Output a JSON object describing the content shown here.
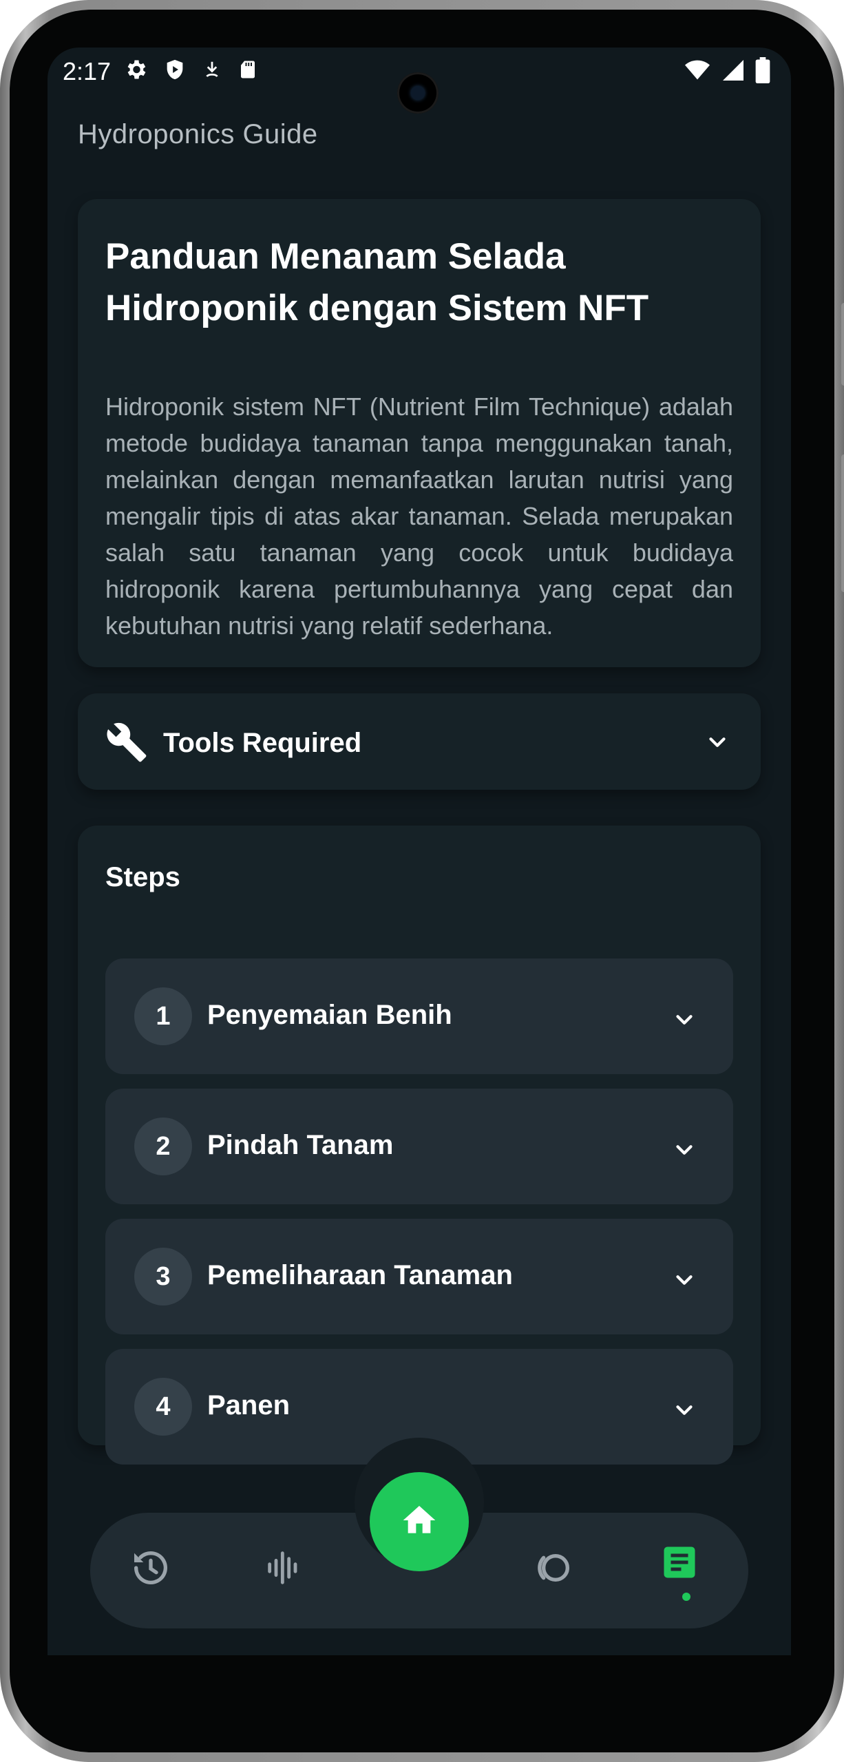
{
  "status_bar": {
    "time": "2:17",
    "left_icons": [
      "gear-icon",
      "shield-play-icon",
      "download-icon",
      "sd-card-icon"
    ],
    "right_icons": [
      "wifi-icon",
      "signal-icon",
      "battery-icon"
    ]
  },
  "app": {
    "title": "Hydroponics Guide"
  },
  "intro": {
    "title": "Panduan Menanam Selada Hidroponik dengan Sistem NFT",
    "description": "Hidroponik sistem NFT (Nutrient Film Technique) adalah metode budidaya tanaman tanpa menggunakan tanah, melainkan dengan memanfaatkan larutan nutrisi yang mengalir tipis di atas akar tanaman. Selada merupakan salah satu tanaman yang cocok untuk budidaya hidroponik karena pertumbuhannya yang cepat dan kebutuhan nutrisi yang relatif sederhana."
  },
  "tools": {
    "label": "Tools Required",
    "icon": "wrench-icon"
  },
  "steps": {
    "heading": "Steps",
    "items": [
      {
        "number": "1",
        "title": "Penyemaian Benih"
      },
      {
        "number": "2",
        "title": "Pindah Tanam"
      },
      {
        "number": "3",
        "title": "Pemeliharaan Tanaman"
      },
      {
        "number": "4",
        "title": "Panen"
      }
    ]
  },
  "bottom_nav": {
    "items": [
      "history-icon",
      "waveform-icon",
      "home-icon",
      "cycle-icon",
      "notes-icon"
    ],
    "active": "notes-icon",
    "accent_color": "#1fc85a"
  },
  "colors": {
    "background": "#10191e",
    "card": "#162227",
    "step_card": "#232e36",
    "accent": "#1fc85a"
  }
}
